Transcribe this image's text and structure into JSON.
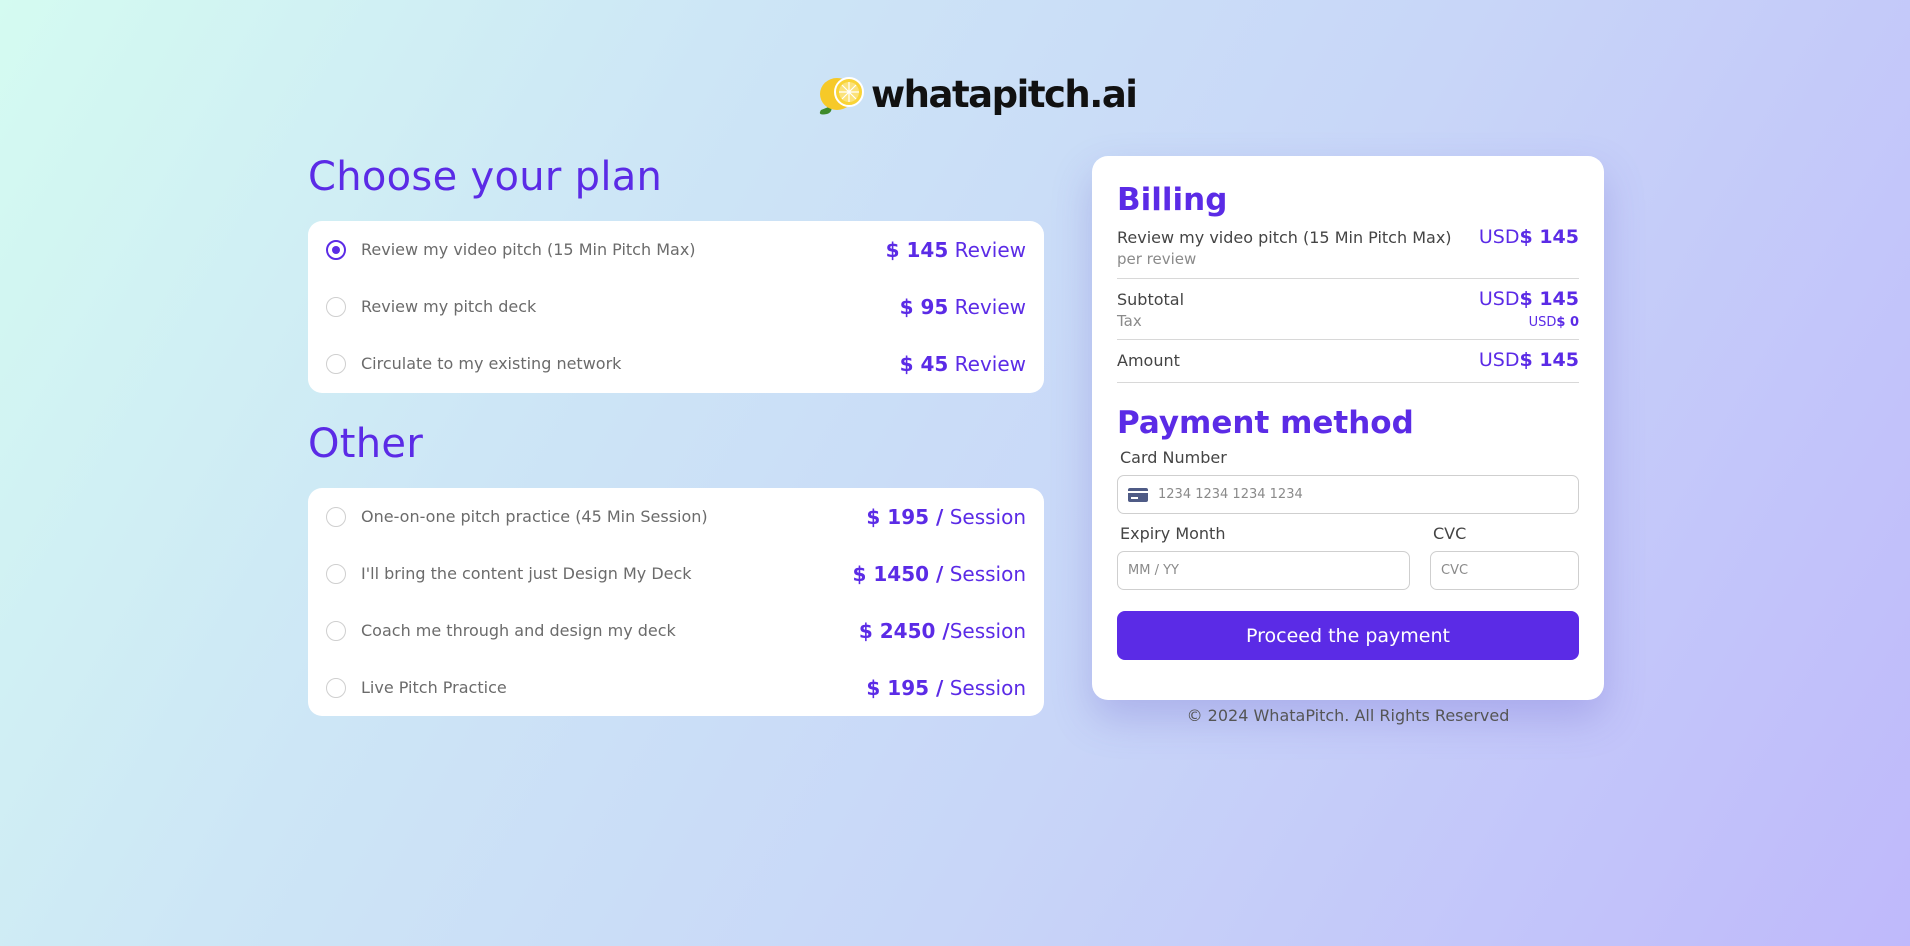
{
  "brand": {
    "name": "whatapitch.ai"
  },
  "plans": {
    "title": "Choose your plan",
    "items": [
      {
        "label": "Review my video pitch (15 Min Pitch Max)",
        "amount": "$ 145",
        "unit": "Review",
        "selected": true
      },
      {
        "label": "Review my pitch deck",
        "amount": "$ 95",
        "unit": "Review",
        "selected": false
      },
      {
        "label": "Circulate to my existing network",
        "amount": "$ 45",
        "unit": "Review",
        "selected": false
      }
    ]
  },
  "other": {
    "title": "Other",
    "items": [
      {
        "label": "One-on-one pitch practice (45 Min Session)",
        "amount": "$ 195 /",
        "unit": "Session",
        "selected": false
      },
      {
        "label": "I'll bring the content just Design My Deck",
        "amount": "$ 1450 /",
        "unit": "Session",
        "selected": false
      },
      {
        "label": "Coach me through and design my deck",
        "amount": "$ 2450 /",
        "unit": "Session",
        "selected": false
      },
      {
        "label": "Live Pitch Practice",
        "amount": "$ 195 /",
        "unit": "Session",
        "selected": false
      }
    ]
  },
  "billing": {
    "title": "Billing",
    "item_label": "Review my video pitch (15 Min Pitch Max)",
    "item_sub": "per review",
    "item_currency": "USD",
    "item_amount": "$ 145",
    "subtotal_label": "Subtotal",
    "subtotal_currency": "USD",
    "subtotal_amount": "$ 145",
    "tax_label": "Tax",
    "tax_currency": "USD",
    "tax_amount": "$ 0",
    "amount_label": "Amount",
    "amount_currency": "USD",
    "amount_value": "$ 145"
  },
  "payment": {
    "title": "Payment method",
    "card_label": "Card Number",
    "card_placeholder": "1234 1234 1234 1234",
    "expiry_label": "Expiry Month",
    "expiry_placeholder": "MM / YY",
    "cvc_label": "CVC",
    "cvc_placeholder": "CVC",
    "button": "Proceed the payment"
  },
  "footer": "© 2024 WhataPitch. All Rights Reserved",
  "colors": {
    "accent": "#5b2be6",
    "logo_lemon": "#f6c928",
    "logo_leaf": "#3d8a2a"
  }
}
